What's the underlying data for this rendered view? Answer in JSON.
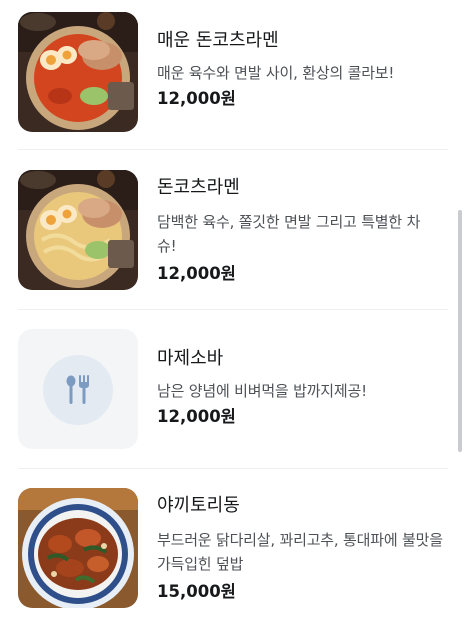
{
  "menu": {
    "items": [
      {
        "name": "매운 돈코츠라멘",
        "description": "매운 육수와 면발 사이, 환상의 콜라보!",
        "price": "12,000원",
        "image": "spicy-ramen-photo"
      },
      {
        "name": "돈코츠라멘",
        "description": "담백한 육수, 쫄깃한 면발 그리고 특별한 차슈!",
        "price": "12,000원",
        "image": "tonkotsu-ramen-photo"
      },
      {
        "name": "마제소바",
        "description": "남은 양념에 비벼먹을 밥까지제공!",
        "price": "12,000원",
        "image": "utensils-placeholder-icon"
      },
      {
        "name": "야끼토리동",
        "description": "부드러운 닭다리살, 꽈리고추, 통대파에 불맛을 가득입힌 덮밥",
        "price": "15,000원",
        "image": "yakitori-don-photo"
      }
    ]
  },
  "colors": {
    "text": "#16181a",
    "description": "#4e5257",
    "divider": "#eef0f2",
    "placeholder_bg": "#f3f5f7",
    "placeholder_icon": "#7b9bc2"
  }
}
